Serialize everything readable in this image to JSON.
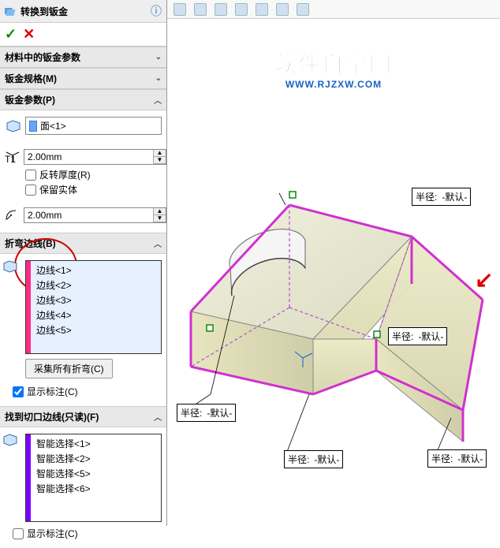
{
  "title": "转换到钣金",
  "sections": {
    "material": {
      "label": "材料中的钣金参数"
    },
    "spec": {
      "label": "钣金规格(M)"
    },
    "params": {
      "label": "钣金参数(P)",
      "face_value": "面<1>",
      "thickness": "2.00mm",
      "reverse": "反转厚度(R)",
      "keep_body": "保留实体",
      "radius": "2.00mm"
    },
    "bend": {
      "label": "折弯边线(B)",
      "items": [
        "边线<1>",
        "边线<2>",
        "边线<3>",
        "边线<4>",
        "边线<5>"
      ],
      "collect_btn": "采集所有折弯(C)",
      "show_note": "显示标注(C)",
      "show_note_checked": true
    },
    "rip": {
      "label": "找到切口边线(只读)(F)",
      "items": [
        "智能选择<1>",
        "智能选择<2>",
        "智能选择<5>",
        "智能选择<6>"
      ],
      "show_note": "显示标注(C)",
      "show_note_checked": false
    }
  },
  "callouts": {
    "label1": "半径:",
    "label2": "-默认-"
  },
  "logo": {
    "line1": "软件自学网",
    "line2": "WWW.RJZXW.COM"
  }
}
